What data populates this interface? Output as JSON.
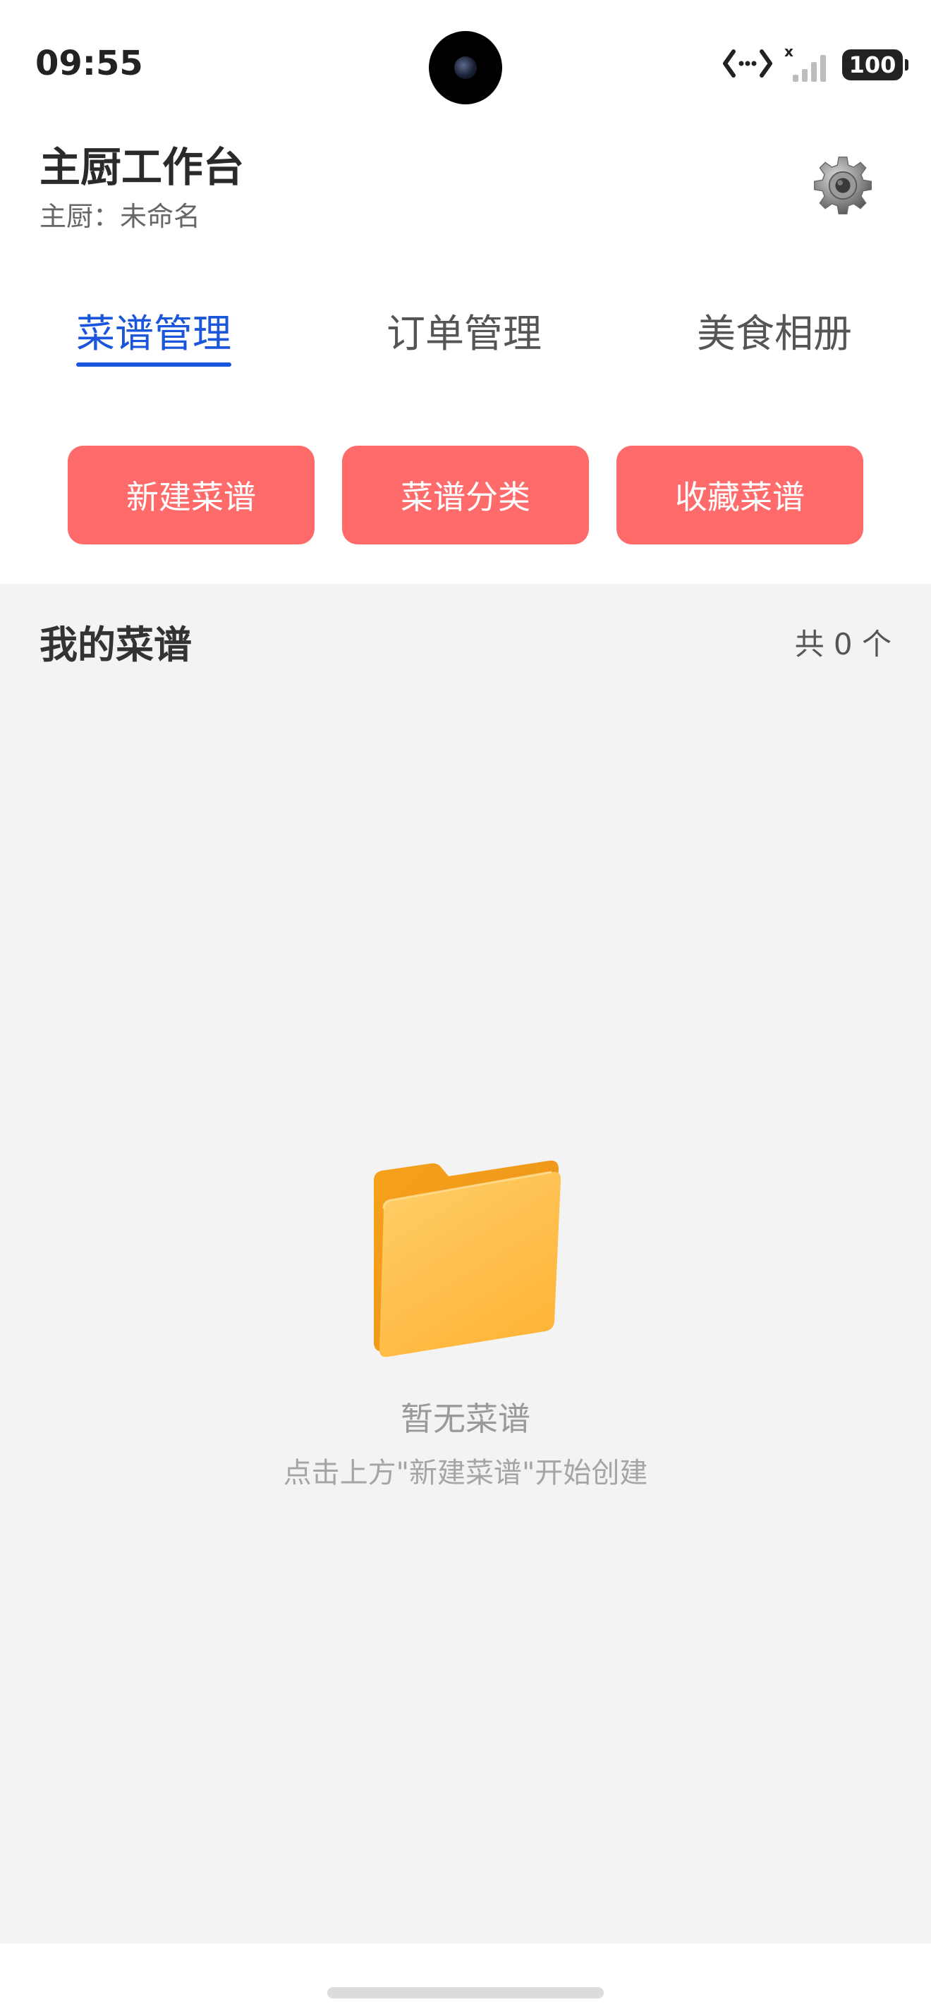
{
  "status_bar": {
    "time": "09:55",
    "battery": "100",
    "icons": [
      "data-transfer-icon",
      "signal-x-icon",
      "signal-bars-icon",
      "battery-icon"
    ]
  },
  "header": {
    "title": "主厨工作台",
    "subtitle_label": "主厨：",
    "subtitle_value": "未命名",
    "settings_icon": "gear-icon"
  },
  "tabs": [
    {
      "label": "菜谱管理",
      "active": true
    },
    {
      "label": "订单管理",
      "active": false
    },
    {
      "label": "美食相册",
      "active": false
    }
  ],
  "actions": [
    {
      "label": "新建菜谱"
    },
    {
      "label": "菜谱分类"
    },
    {
      "label": "收藏菜谱"
    }
  ],
  "recipes": {
    "section_title": "我的菜谱",
    "count_text": "共 0 个",
    "empty_icon": "folder-icon",
    "empty_title": "暂无菜谱",
    "empty_hint": "点击上方\"新建菜谱\"开始创建"
  },
  "colors": {
    "accent_blue": "#1a56db",
    "button_red": "#ff6b6b",
    "content_bg": "#f3f3f3",
    "folder_yellow": "#ffb83a"
  }
}
